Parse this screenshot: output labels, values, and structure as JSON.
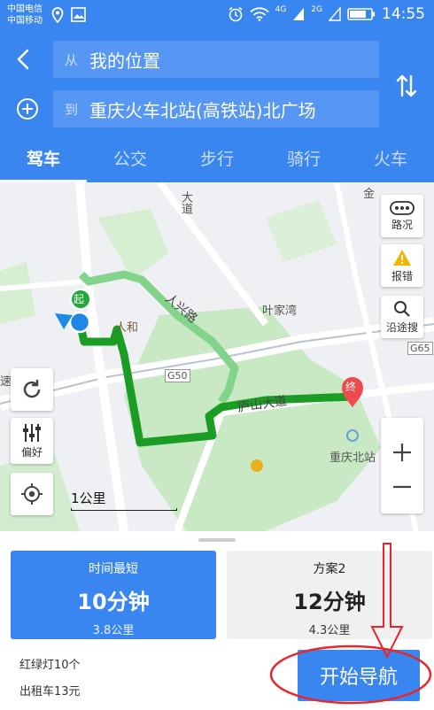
{
  "status_bar": {
    "carrier1": "中国电信",
    "carrier2": "中国移动",
    "net1": "4G",
    "net2": "2G",
    "time": "14:55"
  },
  "route": {
    "from_prefix": "从",
    "from": "我的位置",
    "to_prefix": "到",
    "to": "重庆火车北站(高铁站)北广场"
  },
  "tabs": [
    {
      "label": "驾车"
    },
    {
      "label": "公交"
    },
    {
      "label": "步行"
    },
    {
      "label": "骑行"
    },
    {
      "label": "火车"
    }
  ],
  "map": {
    "buttons": {
      "traffic": "路况",
      "report": "报错",
      "search_along": "沿途搜",
      "preference": "偏好"
    },
    "scale": "1公里",
    "labels": {
      "start": "起",
      "end": "终",
      "renhe": "人和",
      "yejiawan": "叶家湾",
      "g50": "G50",
      "g65": "G65",
      "renxing_road": "人兴路",
      "lushan_road": "庐山大道",
      "chongqing_north": "重庆北站",
      "da_dao": "大道",
      "jin": "金",
      "su": "速"
    }
  },
  "plans": [
    {
      "title": "时间最短",
      "duration": "10分钟",
      "distance": "3.8公里"
    },
    {
      "title": "方案2",
      "duration": "12分钟",
      "distance": "4.3公里"
    }
  ],
  "trip_info": {
    "traffic_lights": "红绿灯10个",
    "taxi": "出租车13元"
  },
  "navigate_label": "开始导航",
  "colors": {
    "primary": "#3a86f0",
    "route": "#1a9c25",
    "alt_route": "#82d48a",
    "annotation": "#e8252b"
  }
}
